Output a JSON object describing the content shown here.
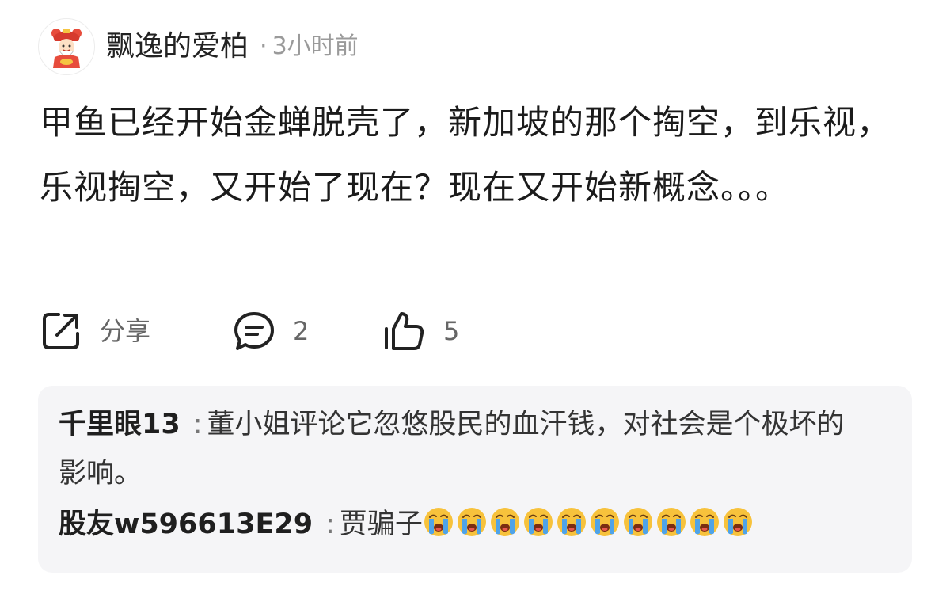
{
  "post": {
    "author": "飘逸的爱柏",
    "separator": "·",
    "time": "3小时前",
    "content": "甲鱼已经开始金蝉脱壳了，新加坡的那个掏空，到乐视，乐视掏空，又开始了现在？现在又开始新概念。。。"
  },
  "actions": {
    "share_label": "分享",
    "comment_count": "2",
    "like_count": "5"
  },
  "comments": [
    {
      "author": "千里眼13",
      "separator": ":",
      "text": "董小姐评论它忽悠股民的血汗钱，对社会是个极坏的影响。"
    },
    {
      "author": "股友w596613E29",
      "separator": ":",
      "text": "贾骗子",
      "emoji": "crying-face",
      "emoji_count": 10
    }
  ],
  "colors": {
    "comment_bg": "#f5f5f7",
    "meta_gray": "#9a9a9a",
    "text_dark": "#1b1b1b"
  }
}
